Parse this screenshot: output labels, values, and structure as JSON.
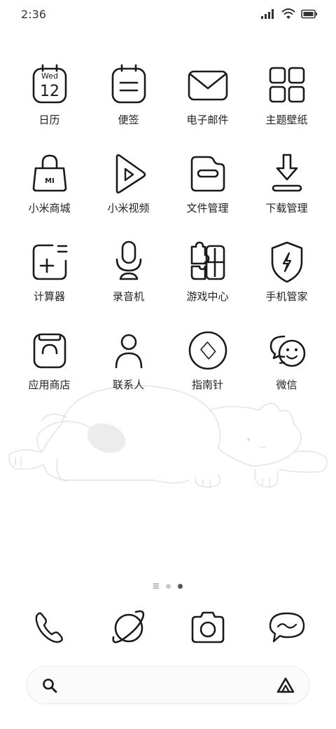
{
  "status": {
    "time": "2:36",
    "icons": [
      "signal-icon",
      "wifi-icon",
      "battery-icon"
    ]
  },
  "apps": [
    {
      "label": "日历",
      "icon": "calendar-icon",
      "calendar_weekday": "Wed",
      "calendar_day": "12"
    },
    {
      "label": "便签",
      "icon": "notes-icon"
    },
    {
      "label": "电子邮件",
      "icon": "email-icon"
    },
    {
      "label": "主题壁纸",
      "icon": "themes-icon"
    },
    {
      "label": "小米商城",
      "icon": "mi-store-icon",
      "bag_text": "MI"
    },
    {
      "label": "小米视频",
      "icon": "mi-video-icon"
    },
    {
      "label": "文件管理",
      "icon": "file-manager-icon"
    },
    {
      "label": "下载管理",
      "icon": "downloads-icon"
    },
    {
      "label": "计算器",
      "icon": "calculator-icon"
    },
    {
      "label": "录音机",
      "icon": "recorder-icon"
    },
    {
      "label": "游戏中心",
      "icon": "game-center-icon"
    },
    {
      "label": "手机管家",
      "icon": "security-icon"
    },
    {
      "label": "应用商店",
      "icon": "app-store-icon"
    },
    {
      "label": "联系人",
      "icon": "contacts-icon"
    },
    {
      "label": "指南针",
      "icon": "compass-icon"
    },
    {
      "label": "微信",
      "icon": "wechat-icon"
    }
  ],
  "pager": {
    "pages": 2,
    "active": 1
  },
  "dock": [
    {
      "icon": "phone-icon"
    },
    {
      "icon": "browser-icon"
    },
    {
      "icon": "camera-icon"
    },
    {
      "icon": "messages-icon"
    }
  ],
  "search": {
    "placeholder": ""
  },
  "colors": {
    "stroke": "#1a1a1a",
    "wallpaper_line": "#e4e4e4",
    "wallpaper_fill": "#ececec",
    "pager_active": "#555555",
    "pager_inactive": "#c8c8c8"
  }
}
